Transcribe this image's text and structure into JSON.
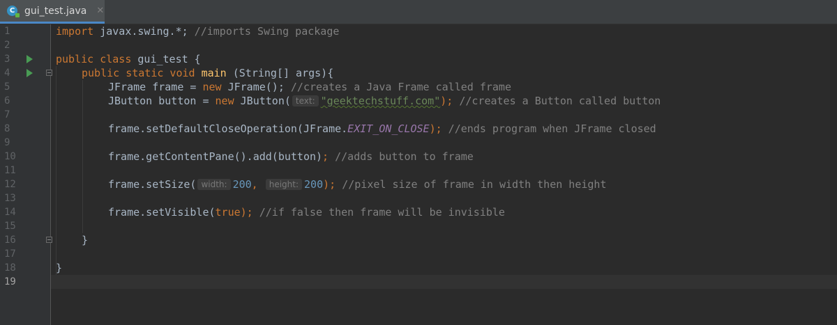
{
  "tab": {
    "icon": "java-class-icon",
    "icon_letter": "C",
    "label": "gui_test.java",
    "close": "✕"
  },
  "editor": {
    "current_line": 19,
    "line_numbers": [
      "1",
      "2",
      "3",
      "4",
      "5",
      "6",
      "7",
      "8",
      "9",
      "10",
      "11",
      "12",
      "13",
      "14",
      "15",
      "16",
      "17",
      "18",
      "19"
    ],
    "code": {
      "l1_kw": "import",
      "l1_rest": " javax.swing.*;",
      "l1_comment": " //imports Swing package",
      "l3_kw": "public class",
      "l3_rest": " gui_test {",
      "l4_kw": "public static void",
      "l4_fn": "main",
      "l4_rest": " (String[] args){",
      "l5_pre": "JFrame frame = ",
      "l5_kw": "new",
      "l5_post": " JFrame();",
      "l5_comment": " //creates a Java Frame called frame",
      "l6_pre": "JButton button = ",
      "l6_kw": "new",
      "l6_post": " JButton(",
      "l6_hint": "text:",
      "l6_str": "\"geektechstuff.com\"",
      "l6_end": ");",
      "l6_comment": " //creates a Button called button",
      "l8_pre": "frame.setDefaultCloseOperation(JFrame.",
      "l8_const": "EXIT_ON_CLOSE",
      "l8_end": ");",
      "l8_comment": " //ends program when JFrame closed",
      "l10_pre": "frame.getContentPane().add(button)",
      "l10_end": ";",
      "l10_comment": " //adds button to frame",
      "l12_pre": "frame.setSize(",
      "l12_hint1": "width:",
      "l12_num1": "200",
      "l12_sep": ",",
      "l12_hint2": "height:",
      "l12_num2": "200",
      "l12_end": ");",
      "l12_comment": " //pixel size of frame in width then height",
      "l14_pre": "frame.setVisible(",
      "l14_kw": "true",
      "l14_end": ");",
      "l14_comment": " //if false then frame will be invisible",
      "l16": "}",
      "l18": "}"
    }
  },
  "colors": {
    "background": "#2b2b2b",
    "keyword": "#cc7832",
    "comment": "#808080",
    "method": "#ffc66d",
    "number": "#6897bb",
    "string": "#6a8759",
    "constant": "#9876aa",
    "run_icon": "#499c54"
  },
  "gutter_icons": {
    "line3": "run-icon",
    "line4": "run-icon",
    "line4_fold": "fold-icon",
    "line16_fold": "fold-icon"
  }
}
